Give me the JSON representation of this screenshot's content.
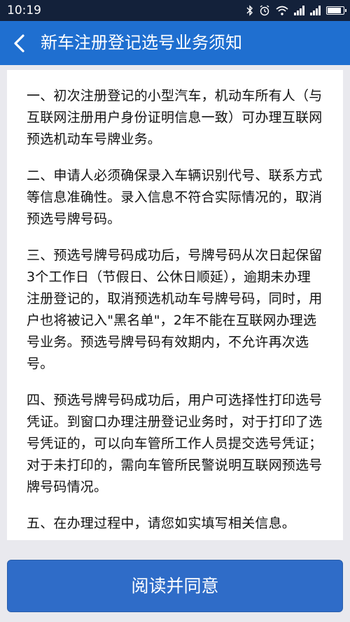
{
  "status_bar": {
    "time": "10:19",
    "icons": [
      "bluetooth-icon",
      "alarm-icon",
      "wifi-icon",
      "signal-icon",
      "signal-icon",
      "battery-icon"
    ],
    "battery_level": 0.9
  },
  "header": {
    "back_icon": "chevron-left-icon",
    "title": "新车注册登记选号业务须知"
  },
  "notice": {
    "paragraphs": [
      "一、初次注册登记的小型汽车，机动车所有人（与互联网注册用户身份证明信息一致）可办理互联网预选机动车号牌业务。",
      "二、申请人必须确保录入车辆识别代号、联系方式等信息准确性。录入信息不符合实际情况的，取消预选号牌号码。",
      "三、预选号牌号码成功后，号牌号码从次日起保留3个工作日（节假日、公休日顺延），逾期未办理注册登记的，取消预选机动车号牌号码，同时，用户也将被记入\"黑名单\"，2年不能在互联网办理选号业务。预选号牌号码有效期内，不允许再次选号。",
      "四、预选号牌号码成功后，用户可选择性打印选号凭证。到窗口办理注册登记业务时，对于打印了选号凭证的，可以向车管所工作人员提交选号凭证；对于未打印的，需向车管所民警说明互联网预选号牌号码情况。",
      "五、在办理过程中，请您如实填写相关信息。"
    ]
  },
  "footer": {
    "agree_label": "阅读并同意"
  },
  "colors": {
    "status_bar": "#13213a",
    "header": "#1f6fd0",
    "button": "#2f6cc8",
    "background": "#e9e9ee"
  }
}
